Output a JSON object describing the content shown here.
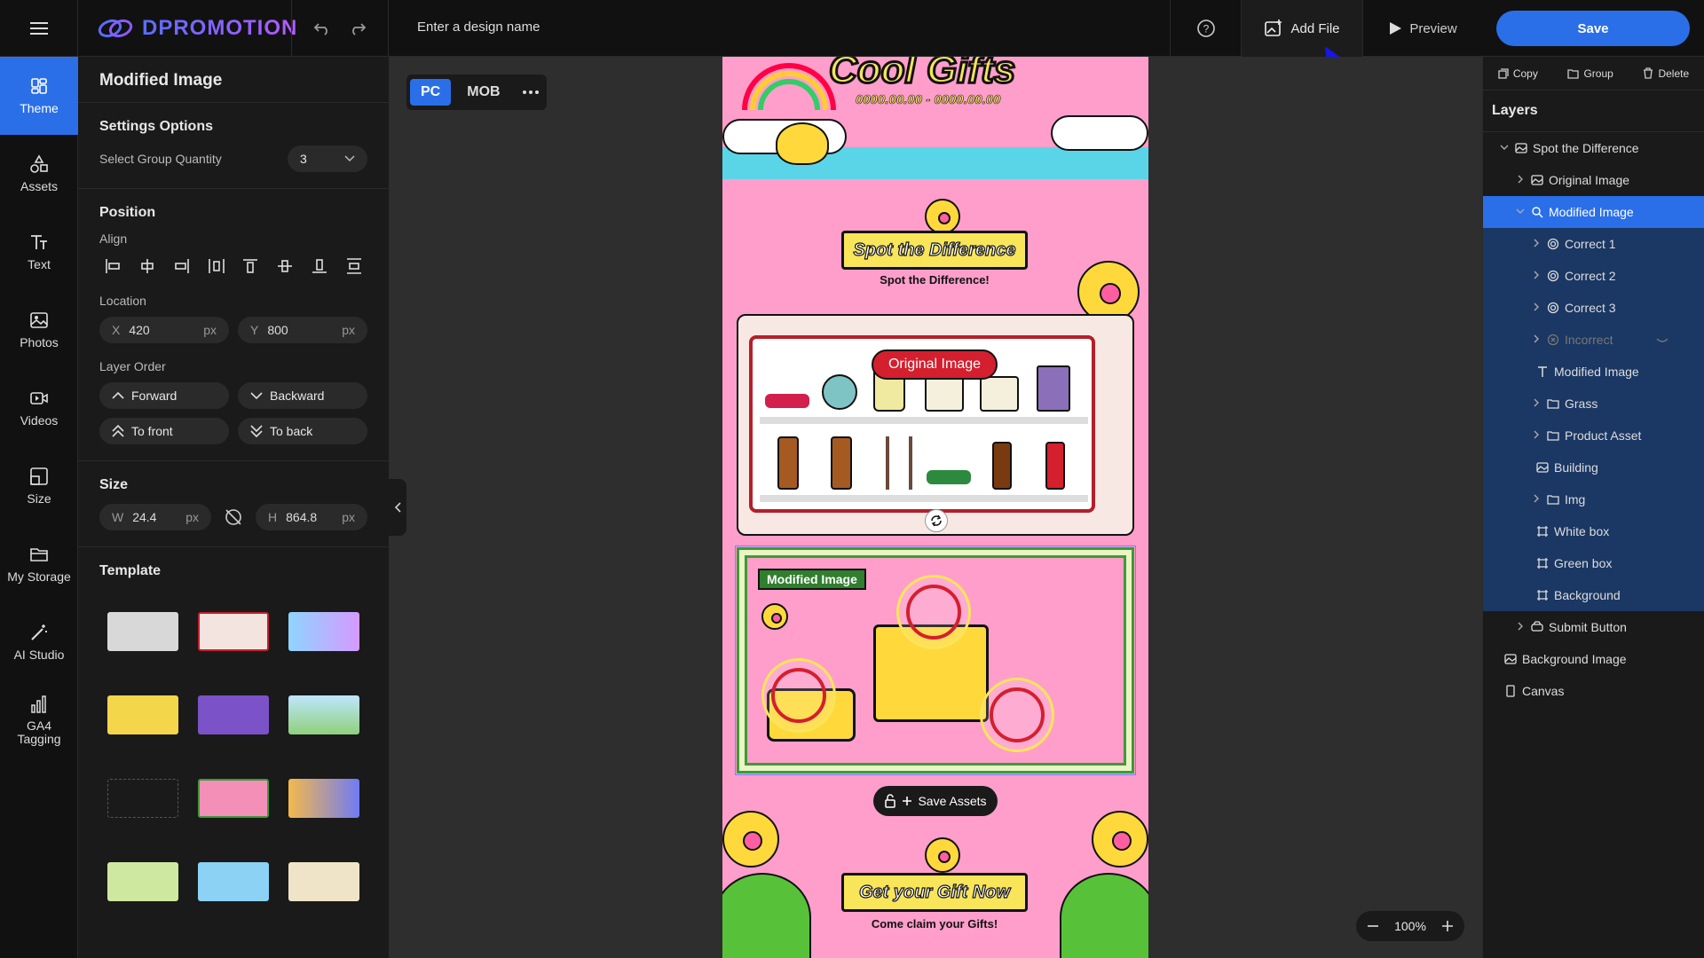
{
  "app": {
    "name": "DPROMOTION",
    "design_name_placeholder": "Enter a design name"
  },
  "toolbar": {
    "add_file": "Add File",
    "preview": "Preview",
    "save": "Save"
  },
  "nav": [
    {
      "label": "Theme",
      "icon": "theme-icon"
    },
    {
      "label": "Assets",
      "icon": "assets-icon"
    },
    {
      "label": "Text",
      "icon": "text-icon"
    },
    {
      "label": "Photos",
      "icon": "photos-icon"
    },
    {
      "label": "Videos",
      "icon": "videos-icon"
    },
    {
      "label": "Size",
      "icon": "size-icon"
    },
    {
      "label": "My Storage",
      "icon": "folder-icon"
    },
    {
      "label": "AI Studio",
      "icon": "wand-icon"
    },
    {
      "label": "GA4 Tagging",
      "icon": "bar-chart-icon"
    }
  ],
  "props": {
    "title": "Modified Image",
    "settings": {
      "heading": "Settings Options",
      "group_qty_label": "Select Group Quantity",
      "group_qty_value": "3"
    },
    "position": {
      "heading": "Position",
      "align_label": "Align",
      "location_label": "Location",
      "x_key": "X",
      "x_value": "420",
      "y_key": "Y",
      "y_value": "800",
      "unit": "px",
      "layer_order_label": "Layer Order",
      "forward": "Forward",
      "backward": "Backward",
      "to_front": "To front",
      "to_back": "To back"
    },
    "size": {
      "heading": "Size",
      "w_key": "W",
      "w_value": "24.4",
      "h_key": "H",
      "h_value": "864.8",
      "unit": "px"
    },
    "template": {
      "heading": "Template"
    }
  },
  "canvas": {
    "device_pc": "PC",
    "device_mob": "MOB",
    "zoom": "100%",
    "art": {
      "title": "Cool Gifts",
      "dates": "0000.00.00 - 0000.00.00",
      "spot_banner": "Spot the Difference",
      "spot_sub": "Spot the Difference!",
      "original_label": "Original Image",
      "modified_label": "Modified Image",
      "save_assets": "Save Assets",
      "gift_banner": "Get your Gift Now",
      "gift_sub": "Come claim your Gifts!"
    }
  },
  "right": {
    "copy": "Copy",
    "group": "Group",
    "delete": "Delete",
    "layers_heading": "Layers",
    "layers": [
      {
        "label": "Spot the Difference",
        "indent": 0,
        "chev": "down",
        "icon": "image-icon",
        "state": ""
      },
      {
        "label": "Original Image",
        "indent": 1,
        "chev": "right",
        "icon": "image-icon",
        "state": ""
      },
      {
        "label": "Modified Image",
        "indent": 1,
        "chev": "down",
        "icon": "search-image-icon",
        "state": "sel"
      },
      {
        "label": "Correct 1",
        "indent": 2,
        "chev": "right",
        "icon": "target-icon",
        "state": "grp"
      },
      {
        "label": "Correct 2",
        "indent": 2,
        "chev": "right",
        "icon": "target-icon",
        "state": "grp"
      },
      {
        "label": "Correct 3",
        "indent": 2,
        "chev": "right",
        "icon": "target-icon",
        "state": "grp"
      },
      {
        "label": "Incorrect",
        "indent": 2,
        "chev": "right",
        "icon": "x-circle-icon",
        "state": "grp dim"
      },
      {
        "label": "Modified Image",
        "indent": 2,
        "chev": "",
        "icon": "text-icon",
        "state": "grp"
      },
      {
        "label": "Grass",
        "indent": 2,
        "chev": "right",
        "icon": "folder-icon",
        "state": "grp"
      },
      {
        "label": "Product Asset",
        "indent": 2,
        "chev": "right",
        "icon": "folder-icon",
        "state": "grp"
      },
      {
        "label": "Building",
        "indent": 2,
        "chev": "",
        "icon": "image-icon",
        "state": "grp"
      },
      {
        "label": "Img",
        "indent": 2,
        "chev": "right",
        "icon": "folder-icon",
        "state": "grp"
      },
      {
        "label": "White box",
        "indent": 2,
        "chev": "",
        "icon": "frame-icon",
        "state": "grp"
      },
      {
        "label": "Green box",
        "indent": 2,
        "chev": "",
        "icon": "frame-icon",
        "state": "grp"
      },
      {
        "label": "Background",
        "indent": 2,
        "chev": "",
        "icon": "frame-icon",
        "state": "grp"
      },
      {
        "label": "Submit Button",
        "indent": 1,
        "chev": "right",
        "icon": "button-icon",
        "state": ""
      },
      {
        "label": "Background Image",
        "indent": 0,
        "chev": "",
        "icon": "image-icon",
        "state": ""
      },
      {
        "label": "Canvas",
        "indent": 0,
        "chev": "",
        "icon": "canvas-icon",
        "state": ""
      }
    ]
  },
  "colors": {
    "accent": "#2a6fe8",
    "panel": "#1a1a1a",
    "canvas_bg": "#2e2e2e",
    "art_pink": "#ff9ecb"
  }
}
